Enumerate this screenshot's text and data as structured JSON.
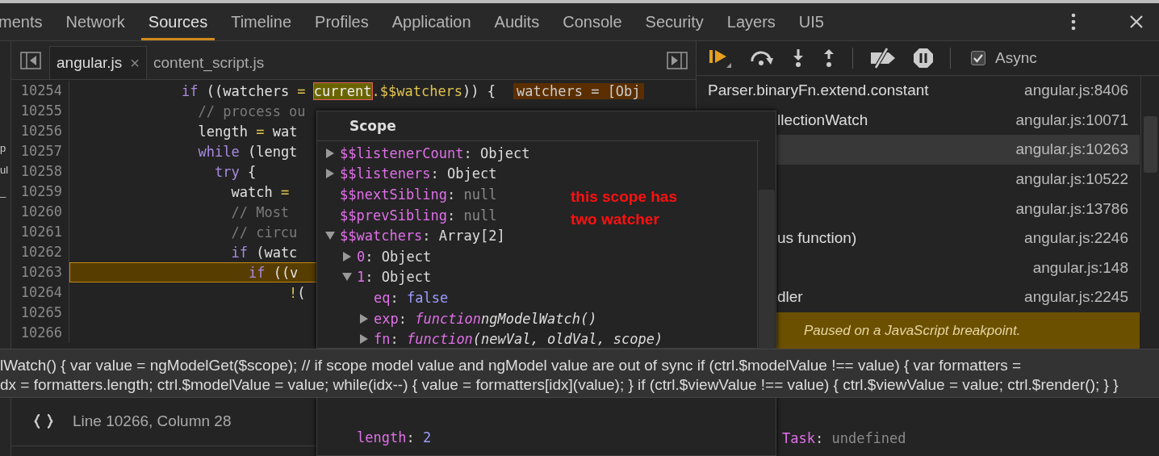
{
  "top_tabs": [
    {
      "label": "ments",
      "selected": false
    },
    {
      "label": "Network",
      "selected": false
    },
    {
      "label": "Sources",
      "selected": true
    },
    {
      "label": "Timeline",
      "selected": false
    },
    {
      "label": "Profiles",
      "selected": false
    },
    {
      "label": "Application",
      "selected": false
    },
    {
      "label": "Audits",
      "selected": false
    },
    {
      "label": "Console",
      "selected": false
    },
    {
      "label": "Security",
      "selected": false
    },
    {
      "label": "Layers",
      "selected": false
    },
    {
      "label": "UI5",
      "selected": false
    }
  ],
  "navigator": [
    "p",
    "ul",
    "_"
  ],
  "file_tabs": [
    {
      "label": "angular.js",
      "selected": true,
      "close": "×"
    },
    {
      "label": "content_script.js",
      "selected": false
    }
  ],
  "code_lines": [
    {
      "number": "10254",
      "current": false,
      "tokens": [
        {
          "kind": "kw",
          "s": "             if"
        },
        {
          "kind": "id",
          "s": " ((watchers "
        },
        {
          "kind": "op",
          "s": "= "
        },
        {
          "kind": "hl",
          "s": "current"
        },
        {
          "kind": "prop",
          "s": ".$$watchers"
        },
        {
          "kind": "id",
          "s": ")) {"
        },
        {
          "kind": "inline",
          "s": "watchers = [Obj"
        }
      ]
    },
    {
      "number": "10255",
      "current": false,
      "tokens": [
        {
          "kind": "cm",
          "s": "               // process ou"
        }
      ]
    },
    {
      "number": "10256",
      "current": false,
      "tokens": [
        {
          "kind": "id",
          "s": "               length "
        },
        {
          "kind": "op",
          "s": "="
        },
        {
          "kind": "id",
          "s": " wat"
        }
      ]
    },
    {
      "number": "10257",
      "current": false,
      "tokens": [
        {
          "kind": "kw",
          "s": "               while"
        },
        {
          "kind": "id",
          "s": " (lengt"
        }
      ]
    },
    {
      "number": "10258",
      "current": false,
      "tokens": [
        {
          "kind": "kw",
          "s": "                 try"
        },
        {
          "kind": "id",
          "s": " {"
        }
      ]
    },
    {
      "number": "10259",
      "current": false,
      "tokens": [
        {
          "kind": "id",
          "s": "                   watch "
        },
        {
          "kind": "op",
          "s": "="
        }
      ]
    },
    {
      "number": "10260",
      "current": false,
      "tokens": [
        {
          "kind": "cm",
          "s": "                   // Most"
        }
      ]
    },
    {
      "number": "10261",
      "current": false,
      "tokens": [
        {
          "kind": "cm",
          "s": "                   // circu"
        }
      ]
    },
    {
      "number": "10262",
      "current": false,
      "tokens": [
        {
          "kind": "kw",
          "s": "                   if"
        },
        {
          "kind": "id",
          "s": " (watc"
        }
      ]
    },
    {
      "number": "10263",
      "current": true,
      "tokens": [
        {
          "kind": "kw",
          "s": "                     if"
        },
        {
          "kind": "id",
          "s": " ((v"
        }
      ]
    },
    {
      "number": "10264",
      "current": false,
      "tokens": [
        {
          "kind": "op",
          "s": "                          !"
        },
        {
          "kind": "id",
          "s": "("
        }
      ]
    },
    {
      "number": "10265",
      "current": false
    },
    {
      "number": "10266",
      "current": false
    }
  ],
  "status_bar": {
    "position": "Line 10266, Column 28"
  },
  "scope_popover": {
    "title": "Scope",
    "annotation": "this scope has two watcher",
    "items": [
      {
        "key": "$$listenerCount",
        "sep": ":",
        "value": "Object",
        "kind": "object",
        "expanded": false
      },
      {
        "key": "$$listeners",
        "sep": ":",
        "value": "Object",
        "kind": "object",
        "expanded": false
      },
      {
        "key": "$$nextSibling",
        "sep": ":",
        "value": "null",
        "kind": "null"
      },
      {
        "key": "$$prevSibling",
        "sep": ":",
        "value": "null",
        "kind": "null"
      },
      {
        "key": "$$watchers",
        "sep": ":",
        "value": "Array[2]",
        "kind": "object",
        "expanded": true,
        "children": [
          {
            "key": "0",
            "sep": ":",
            "value": "Object",
            "kind": "object",
            "expanded": false
          },
          {
            "key": "1",
            "sep": ":",
            "value": "Object",
            "kind": "object",
            "expanded": true,
            "children": [
              {
                "key": "eq",
                "sep": ":",
                "value": "false",
                "kind": "bool"
              },
              {
                "key": "exp",
                "sep": ":",
                "keyword": "function",
                "value": "ngModelWatch()",
                "kind": "function",
                "expanded": false
              },
              {
                "key": "fn",
                "sep": ":",
                "keyword": "function",
                "value": "(newVal, oldVal, scope)",
                "kind": "function",
                "expanded": false
              }
            ]
          }
        ]
      }
    ],
    "lower_items": [
      {
        "key": "length",
        "sep": ":",
        "value": "2",
        "kind": "number"
      }
    ]
  },
  "debugger": {
    "async": {
      "label": "Async",
      "checked": true
    },
    "call_stack": [
      {
        "name": "Parser.binaryFn.extend.constant",
        "location": "angular.js:8406",
        "selected": false
      },
      {
        "name": "llectionWatch",
        "location": "angular.js:10071",
        "selected": false
      },
      {
        "location": "angular.js:10263",
        "selected": true
      },
      {
        "location": "angular.js:10522",
        "selected": false
      },
      {
        "location": "angular.js:13786",
        "selected": false
      },
      {
        "name": "us function)",
        "location": "angular.js:2246",
        "selected": false
      },
      {
        "location": "angular.js:148",
        "selected": false
      },
      {
        "name": "dler",
        "location": "angular.js:2245",
        "selected": false
      }
    ],
    "paused_message": "Paused on a JavaScript breakpoint.",
    "scope_vars": [
      {
        "key": "Task",
        "sep": ":",
        "value": "undefined"
      }
    ]
  },
  "tooltip": {
    "lines": [
      "lWatch() { var value = ngModelGet($scope); // if scope model value and ngModel value are out of sync if (ctrl.$modelValue !== value) { var formatters =",
      "dx = formatters.length; ctrl.$modelValue = value; while(idx--) { value = formatters[idx](value); } if (ctrl.$viewValue !== value) { ctrl.$viewValue = value; ctrl.$render(); } }"
    ]
  }
}
